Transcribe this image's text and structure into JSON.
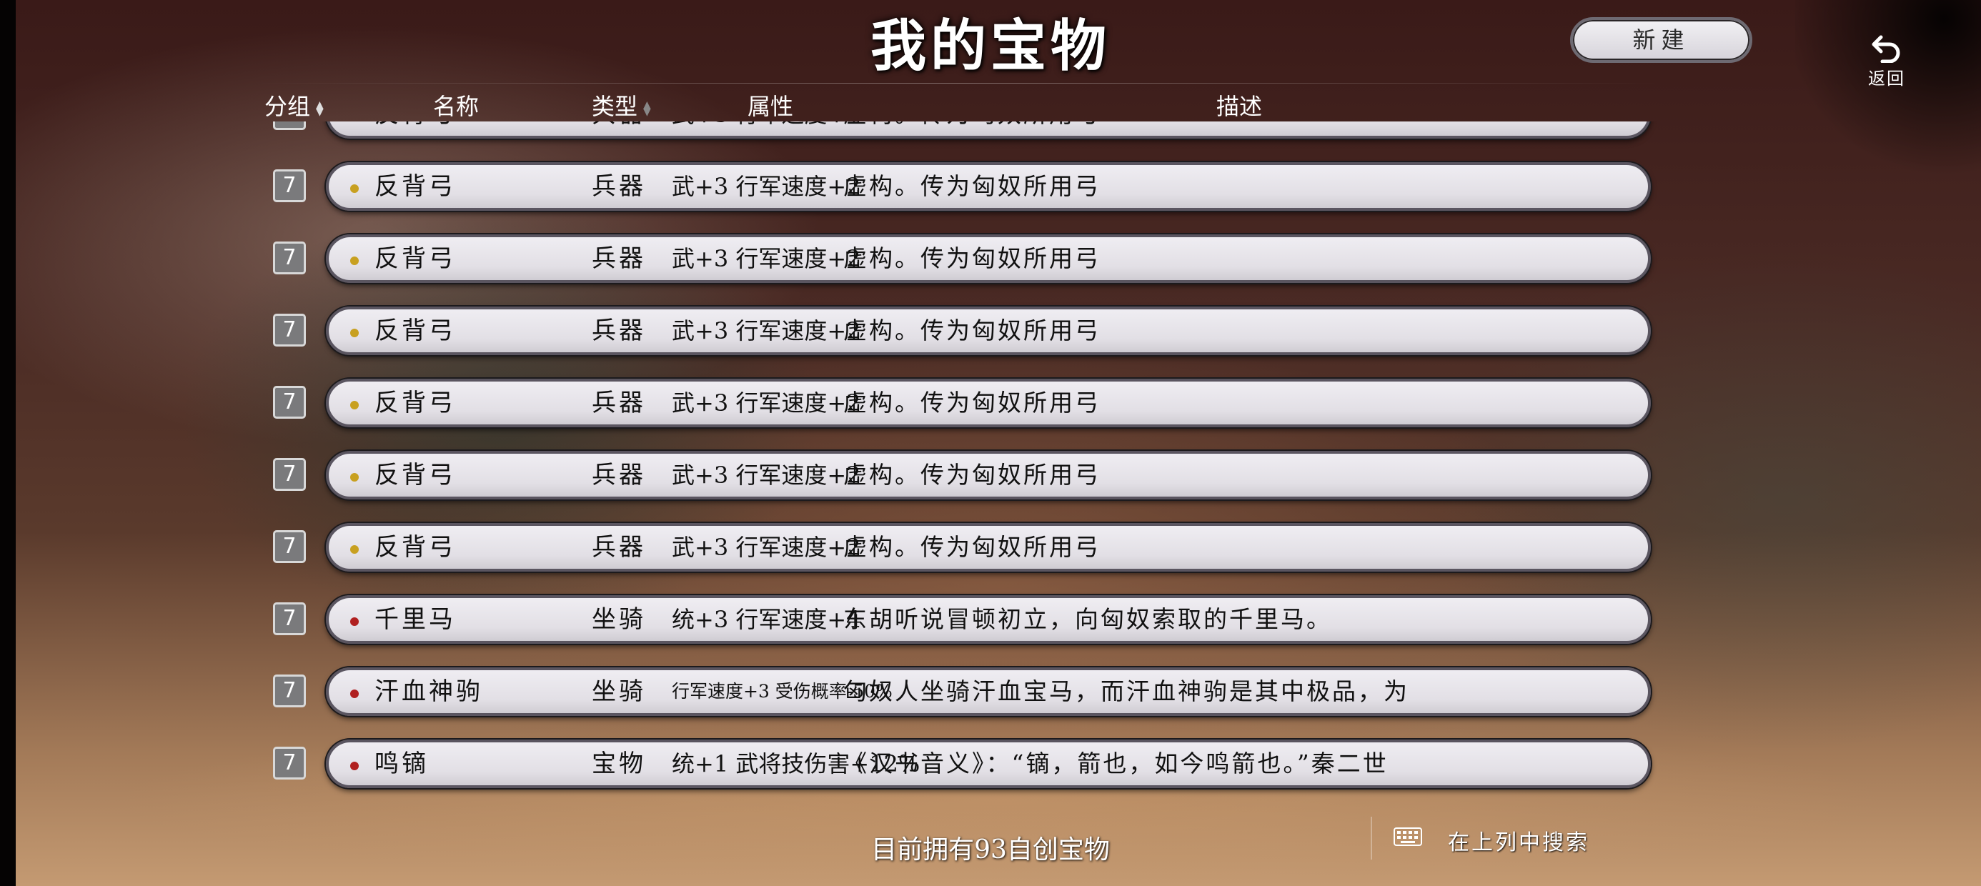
{
  "title": "我的宝物",
  "new_button": "新建",
  "back_label": "返回",
  "columns": {
    "group": "分组",
    "name": "名称",
    "type": "类型",
    "attr": "属性",
    "desc": "描述"
  },
  "rows": [
    {
      "group": "7",
      "name": "反背弓",
      "type": "兵器",
      "attr": "武+3 行军速度+2",
      "desc": "虚构。传为匈奴所用弓",
      "dot": "#c8a020",
      "attr_small": false
    },
    {
      "group": "7",
      "name": "反背弓",
      "type": "兵器",
      "attr": "武+3 行军速度+2",
      "desc": "虚构。传为匈奴所用弓",
      "dot": "#c8a020",
      "attr_small": false
    },
    {
      "group": "7",
      "name": "反背弓",
      "type": "兵器",
      "attr": "武+3 行军速度+2",
      "desc": "虚构。传为匈奴所用弓",
      "dot": "#c8a020",
      "attr_small": false
    },
    {
      "group": "7",
      "name": "反背弓",
      "type": "兵器",
      "attr": "武+3 行军速度+2",
      "desc": "虚构。传为匈奴所用弓",
      "dot": "#c8a020",
      "attr_small": false
    },
    {
      "group": "7",
      "name": "反背弓",
      "type": "兵器",
      "attr": "武+3 行军速度+2",
      "desc": "虚构。传为匈奴所用弓",
      "dot": "#c8a020",
      "attr_small": false
    },
    {
      "group": "7",
      "name": "反背弓",
      "type": "兵器",
      "attr": "武+3 行军速度+2",
      "desc": "虚构。传为匈奴所用弓",
      "dot": "#c8a020",
      "attr_small": false
    },
    {
      "group": "7",
      "name": "反背弓",
      "type": "兵器",
      "attr": "武+3 行军速度+2",
      "desc": "虚构。传为匈奴所用弓",
      "dot": "#c8a020",
      "attr_small": false
    },
    {
      "group": "7",
      "name": "千里马",
      "type": "坐骑",
      "attr": "统+3 行军速度+4",
      "desc": "东胡听说冒顿初立，向匈奴索取的千里马。",
      "dot": "#b02020",
      "attr_small": false
    },
    {
      "group": "7",
      "name": "汗血神驹",
      "type": "坐骑",
      "attr": "行军速度+3 受伤概率-50%",
      "desc": "匈奴人坐骑汗血宝马，而汗血神驹是其中极品，为",
      "dot": "#b02020",
      "attr_small": true
    },
    {
      "group": "7",
      "name": "鸣镝",
      "type": "宝物",
      "attr": "统+1 武将技伤害+12%",
      "desc": "《汉书音义》：“镝，箭也，如今鸣箭也。”秦二世",
      "dot": "#b02020",
      "attr_small": false
    }
  ],
  "footer_count": "目前拥有93自创宝物",
  "search_label": "在上列中搜索"
}
